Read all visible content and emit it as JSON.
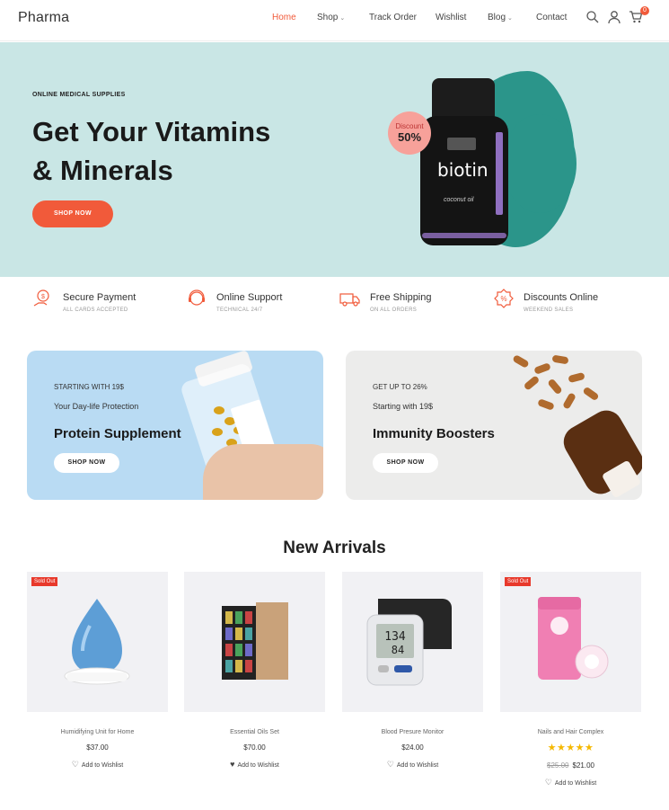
{
  "header": {
    "logo": "Pharma",
    "nav": [
      {
        "label": "Home",
        "active": true,
        "dropdown": false
      },
      {
        "label": "Shop",
        "active": false,
        "dropdown": true
      },
      {
        "label": "Track Order",
        "active": false,
        "dropdown": false
      },
      {
        "label": "Wishlist",
        "active": false,
        "dropdown": false
      },
      {
        "label": "Blog",
        "active": false,
        "dropdown": true
      },
      {
        "label": "Contact",
        "active": false,
        "dropdown": false
      }
    ],
    "icons": [
      "search-icon",
      "user-icon",
      "cart-icon"
    ],
    "cart_count": "0"
  },
  "hero": {
    "eyebrow": "ONLINE MEDICAL SUPPLIES",
    "title_line1": "Get Your Vitamins",
    "title_line2": "& Minerals",
    "button": "SHOP NOW",
    "product_name": "biotin",
    "product_sub": "coconut oil",
    "discount_label": "Discount",
    "discount_value": "50%",
    "bg_color": "#c9e6e5",
    "accent": "#f15a3a"
  },
  "features": [
    {
      "title": "Secure Payment",
      "subtitle": "ALL CARDS ACCEPTED",
      "icon": "secure-payment-icon"
    },
    {
      "title": "Online Support",
      "subtitle": "TECHNICAL 24/7",
      "icon": "support-icon"
    },
    {
      "title": "Free Shipping",
      "subtitle": "ON ALL ORDERS",
      "icon": "truck-icon"
    },
    {
      "title": "Discounts Online",
      "subtitle": "WEEKEND SALES",
      "icon": "discount-icon"
    }
  ],
  "promos": [
    {
      "eyebrow": "STARTING WITH 19$",
      "subtitle": "Your Day-life Protection",
      "title": "Protein Supplement",
      "button": "SHOP NOW"
    },
    {
      "eyebrow": "GET UP TO 26%",
      "subtitle": "Starting with 19$",
      "title": "Immunity Boosters",
      "button": "SHOP NOW"
    }
  ],
  "new_arrivals": {
    "title": "New Arrivals",
    "products": [
      {
        "name": "Humidifying Unit for Home",
        "price": "$37.00",
        "old_price": "",
        "sold_out": "Sold Out",
        "rating": "",
        "wishlist": "Add to Wishlist"
      },
      {
        "name": "Essential Oils Set",
        "price": "$70.00",
        "old_price": "",
        "sold_out": "",
        "rating": "",
        "wishlist": "Add to Wishlist"
      },
      {
        "name": "Blood Presure Monitor",
        "price": "$24.00",
        "old_price": "",
        "sold_out": "",
        "rating": "",
        "wishlist": "Add to Wishlist"
      },
      {
        "name": "Nails and Hair Complex",
        "price": "$21.00",
        "old_price": "$25.00",
        "sold_out": "Sold Out",
        "rating": "★★★★★",
        "wishlist": "Add to Wishlist"
      }
    ]
  }
}
